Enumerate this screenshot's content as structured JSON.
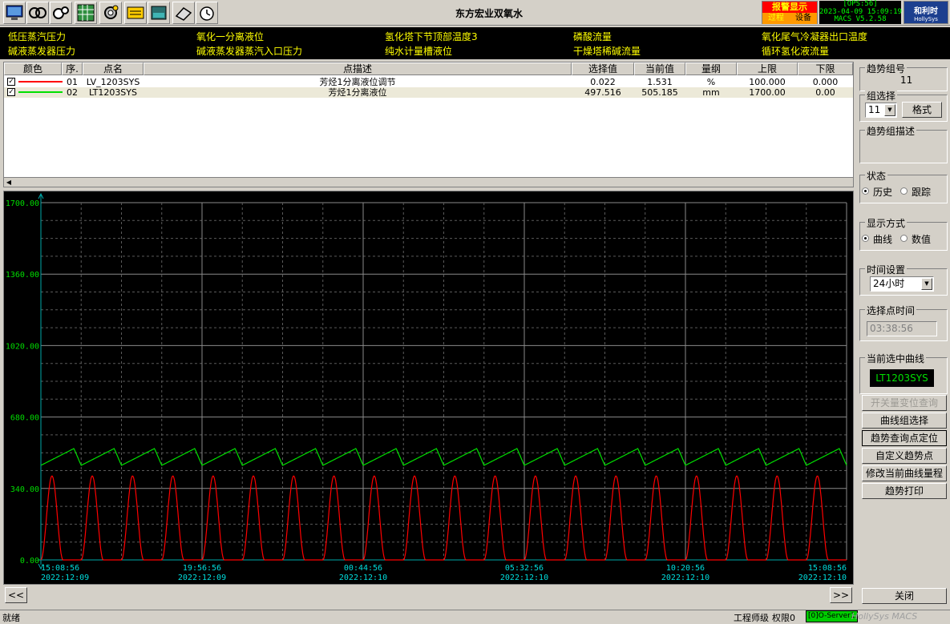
{
  "window": {
    "title": "东方宏业双氧水"
  },
  "toolbar": {
    "icons": [
      "monitor-icon",
      "handshake-icon",
      "gears-icon",
      "grid-icon",
      "settings-icon",
      "panel-icon",
      "tank-icon",
      "folder-icon",
      "clock-icon"
    ]
  },
  "header": {
    "alarm_title": "报警显示",
    "alarm_sub1": "过程",
    "alarm_sub2": "设备",
    "ops_line1": "[OPS:56]",
    "ops_line2": "2023-04-09 15:09:19",
    "ops_line3": "MACS V5.2.58",
    "logo_text": "和利时",
    "logo_sub": "HollySys"
  },
  "alarm_strip": {
    "items": [
      "低压蒸汽压力",
      "氧化一分离液位",
      "氢化塔下节顶部温度3",
      "磷酸流量",
      "氧化尾气冷凝器出口温度",
      "碱液蒸发器压力",
      "碱液蒸发器蒸汽入口压力",
      "纯水计量槽液位",
      "干燥塔稀碱流量",
      "循环氢化液流量"
    ]
  },
  "table": {
    "headers": {
      "color": "颜色",
      "seq": "序.",
      "name": "点名",
      "desc": "点描述",
      "selected": "选择值",
      "current": "当前值",
      "unit": "量纲",
      "upper": "上限",
      "lower": "下限"
    },
    "rows": [
      {
        "color": "#ff0000",
        "seq": "01",
        "name": "LV_1203SYS",
        "desc": "芳烃1分离液位调节",
        "selected": "0.022",
        "current": "1.531",
        "unit": "%",
        "upper": "100.000",
        "lower": "0.000"
      },
      {
        "color": "#00e000",
        "seq": "02",
        "name": "LT1203SYS",
        "desc": "芳烃1分离液位",
        "selected": "497.516",
        "current": "505.185",
        "unit": "mm",
        "upper": "1700.00",
        "lower": "0.00"
      }
    ]
  },
  "chart_data": {
    "type": "line",
    "y_tick_labels": [
      "1700.00",
      "1360.00",
      "1020.00",
      "680.00",
      "340.00",
      "0.00"
    ],
    "ylim": [
      0,
      1700
    ],
    "x_tick_labels": [
      {
        "time": "15:08:56",
        "date": "2022:12:09"
      },
      {
        "time": "19:56:56",
        "date": "2022:12:09"
      },
      {
        "time": "00:44:56",
        "date": "2022:12:10"
      },
      {
        "time": "05:32:56",
        "date": "2022:12:10"
      },
      {
        "time": "10:20:56",
        "date": "2022:12:10"
      },
      {
        "time": "15:08:56",
        "date": "2022:12:10"
      }
    ],
    "x_range_hours": 24,
    "grid": true,
    "series": [
      {
        "name": "LT1203SYS",
        "color": "#00e000",
        "pattern": "sawtooth",
        "low": 450,
        "high": 530,
        "cycles": 20
      },
      {
        "name": "LV_1203SYS",
        "color": "#ff0000",
        "pattern": "pulse",
        "low": 0,
        "high": 400,
        "cycles": 20,
        "pulse_width_fraction": 0.55
      }
    ]
  },
  "right_panel": {
    "trend_group_label": "趋势组号",
    "trend_group_value": "11",
    "group_select_label": "组选择",
    "group_select_value": "11",
    "format_button": "格式",
    "group_desc_label": "趋势组描述",
    "state_label": "状态",
    "state_history": "历史",
    "state_track": "跟踪",
    "display_label": "显示方式",
    "display_curve": "曲线",
    "display_value": "数值",
    "time_setting_label": "时间设置",
    "time_setting_value": "24小时",
    "select_time_label": "选择点时间",
    "select_time_value": "03:38:56",
    "current_curve_label": "当前选中曲线",
    "current_curve_value": "LT1203SYS",
    "buttons": [
      "开关量变位查询",
      "曲线组选择",
      "趋势查询点定位",
      "自定义趋势点",
      "修改当前曲线量程",
      "趋势打印"
    ],
    "close_button": "关闭"
  },
  "nav": {
    "prev": "<<",
    "next": ">>"
  },
  "statusbar": {
    "ready": "就绪",
    "role": "工程师级",
    "perm": "权限0",
    "server": "[0]O-Server1",
    "brand": "HollySys MACS"
  }
}
